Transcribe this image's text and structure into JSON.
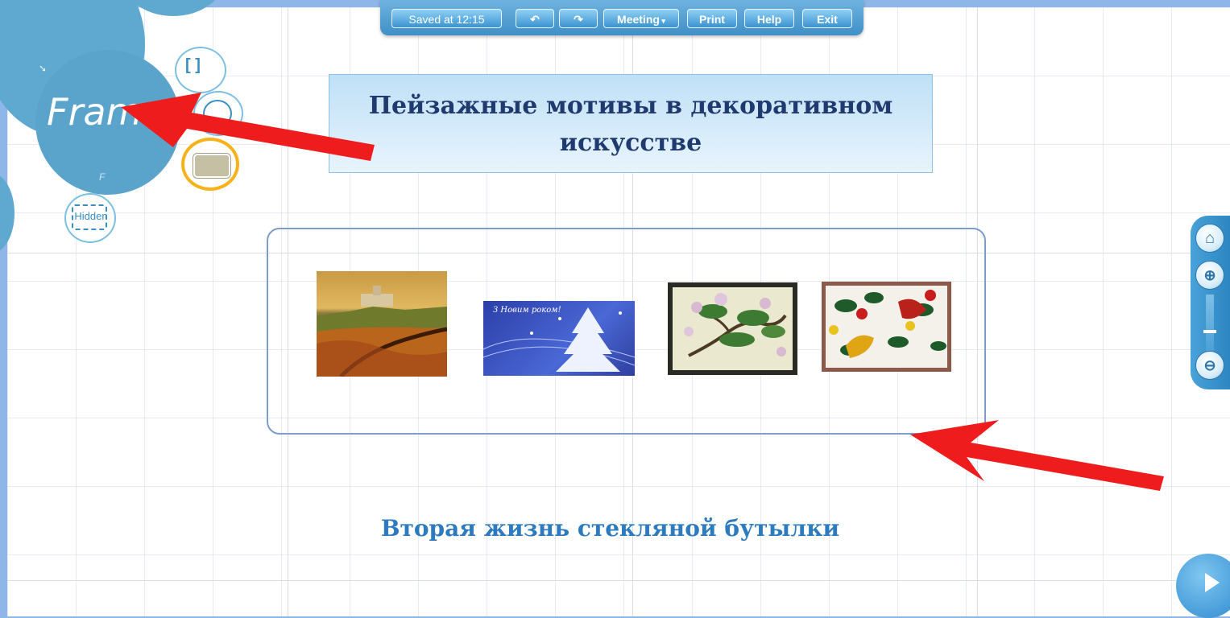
{
  "toolbar": {
    "saved_label": "Saved at 12:15",
    "undo_label": "↶",
    "redo_label": "↷",
    "meeting_label": "Meeting",
    "print_label": "Print",
    "help_label": "Help",
    "exit_label": "Exit"
  },
  "bubble_menu": {
    "frame_label": "Frame",
    "bracket_label": "[ ]",
    "hidden_label": "Hidden",
    "f_label": "F"
  },
  "slide": {
    "title_line1": "Пейзажные мотивы в декоративном",
    "title_line2": "искусстве",
    "subtitle": "Вторая жизнь стекляной бутылки",
    "card_text": "З Новим роком!"
  },
  "colors": {
    "accent": "#3f8fc6",
    "arrow": "#ee1c1c",
    "highlight": "#f7b21b"
  }
}
